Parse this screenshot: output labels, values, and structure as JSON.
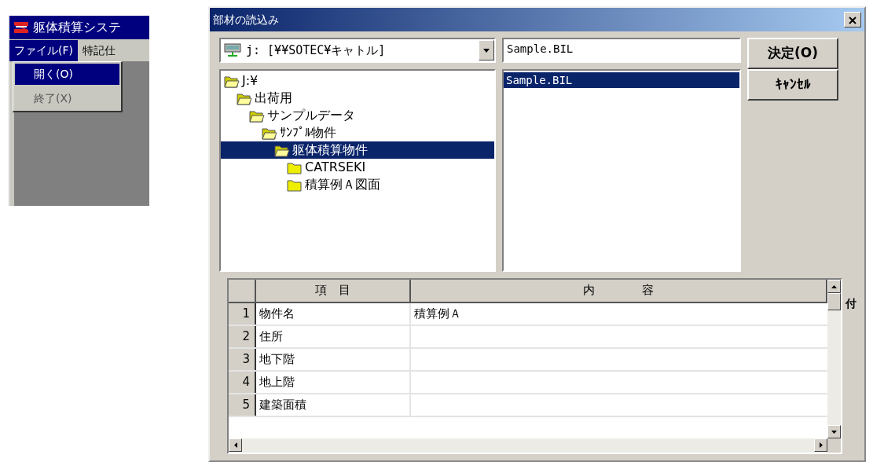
{
  "app_window": {
    "title": "躯体積算システ",
    "menu": [
      {
        "label": "ファイル(F)",
        "selected": true
      },
      {
        "label": "特記仕",
        "selected": false
      }
    ],
    "dropdown": [
      {
        "label": "開く(O)",
        "selected": true
      },
      {
        "label": "終了(X)",
        "selected": false
      }
    ]
  },
  "dialog": {
    "title": "部材の読込み",
    "drive": "j: [¥¥SOTEC¥キャトル]",
    "file_name": "Sample.BIL",
    "tree": [
      {
        "label": "J:¥",
        "expanded": true,
        "selected": false,
        "children": [
          {
            "label": "出荷用",
            "expanded": true,
            "selected": false,
            "children": [
              {
                "label": "サンプルデータ",
                "expanded": true,
                "selected": false,
                "children": [
                  {
                    "label": "ｻﾝﾌﾟﾙ物件",
                    "expanded": true,
                    "selected": false,
                    "children": [
                      {
                        "label": "躯体積算物件",
                        "expanded": true,
                        "selected": true,
                        "children": [
                          {
                            "label": "CATRSEKI",
                            "expanded": false,
                            "selected": false
                          },
                          {
                            "label": "積算例Ａ図面",
                            "expanded": false,
                            "selected": false
                          }
                        ]
                      }
                    ]
                  }
                ]
              }
            ]
          }
        ]
      }
    ],
    "files": [
      {
        "name": "Sample.BIL",
        "selected": true
      }
    ],
    "buttons": [
      "決定(O)",
      "ｷｬﾝｾﾙ"
    ],
    "grid": {
      "columns": [
        "項　目",
        "内　　　　容"
      ],
      "rows": [
        {
          "number": "1",
          "item": "物件名",
          "content": "積算例Ａ"
        },
        {
          "number": "2",
          "item": "住所",
          "content": ""
        },
        {
          "number": "3",
          "item": "地下階",
          "content": ""
        },
        {
          "number": "4",
          "item": "地上階",
          "content": ""
        },
        {
          "number": "5",
          "item": "建築面積",
          "content": ""
        }
      ]
    },
    "side_label": "付"
  }
}
